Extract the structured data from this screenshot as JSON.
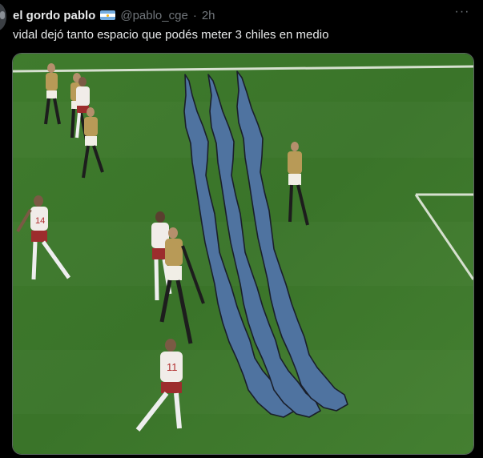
{
  "tweet": {
    "author_name": "el gordo pablo",
    "handle": "@pablo_cge",
    "separator": "·",
    "time": "2h",
    "text": "vidal dejó tanto espacio que podés meter 3 chiles en medio",
    "more_icon": "more-horizontal-icon"
  },
  "media": {
    "pitch_color": "#3e7a2c",
    "overlay_color": "#4f73a0",
    "players": [
      {
        "kit": "gold",
        "number": ""
      },
      {
        "kit": "gold",
        "number": ""
      },
      {
        "kit": "white",
        "number": ""
      },
      {
        "kit": "gold",
        "number": ""
      },
      {
        "kit": "gold",
        "number": ""
      },
      {
        "kit": "white",
        "number": "14"
      },
      {
        "kit": "white",
        "number": ""
      },
      {
        "kit": "gold",
        "number": ""
      },
      {
        "kit": "white",
        "number": "11"
      }
    ]
  }
}
